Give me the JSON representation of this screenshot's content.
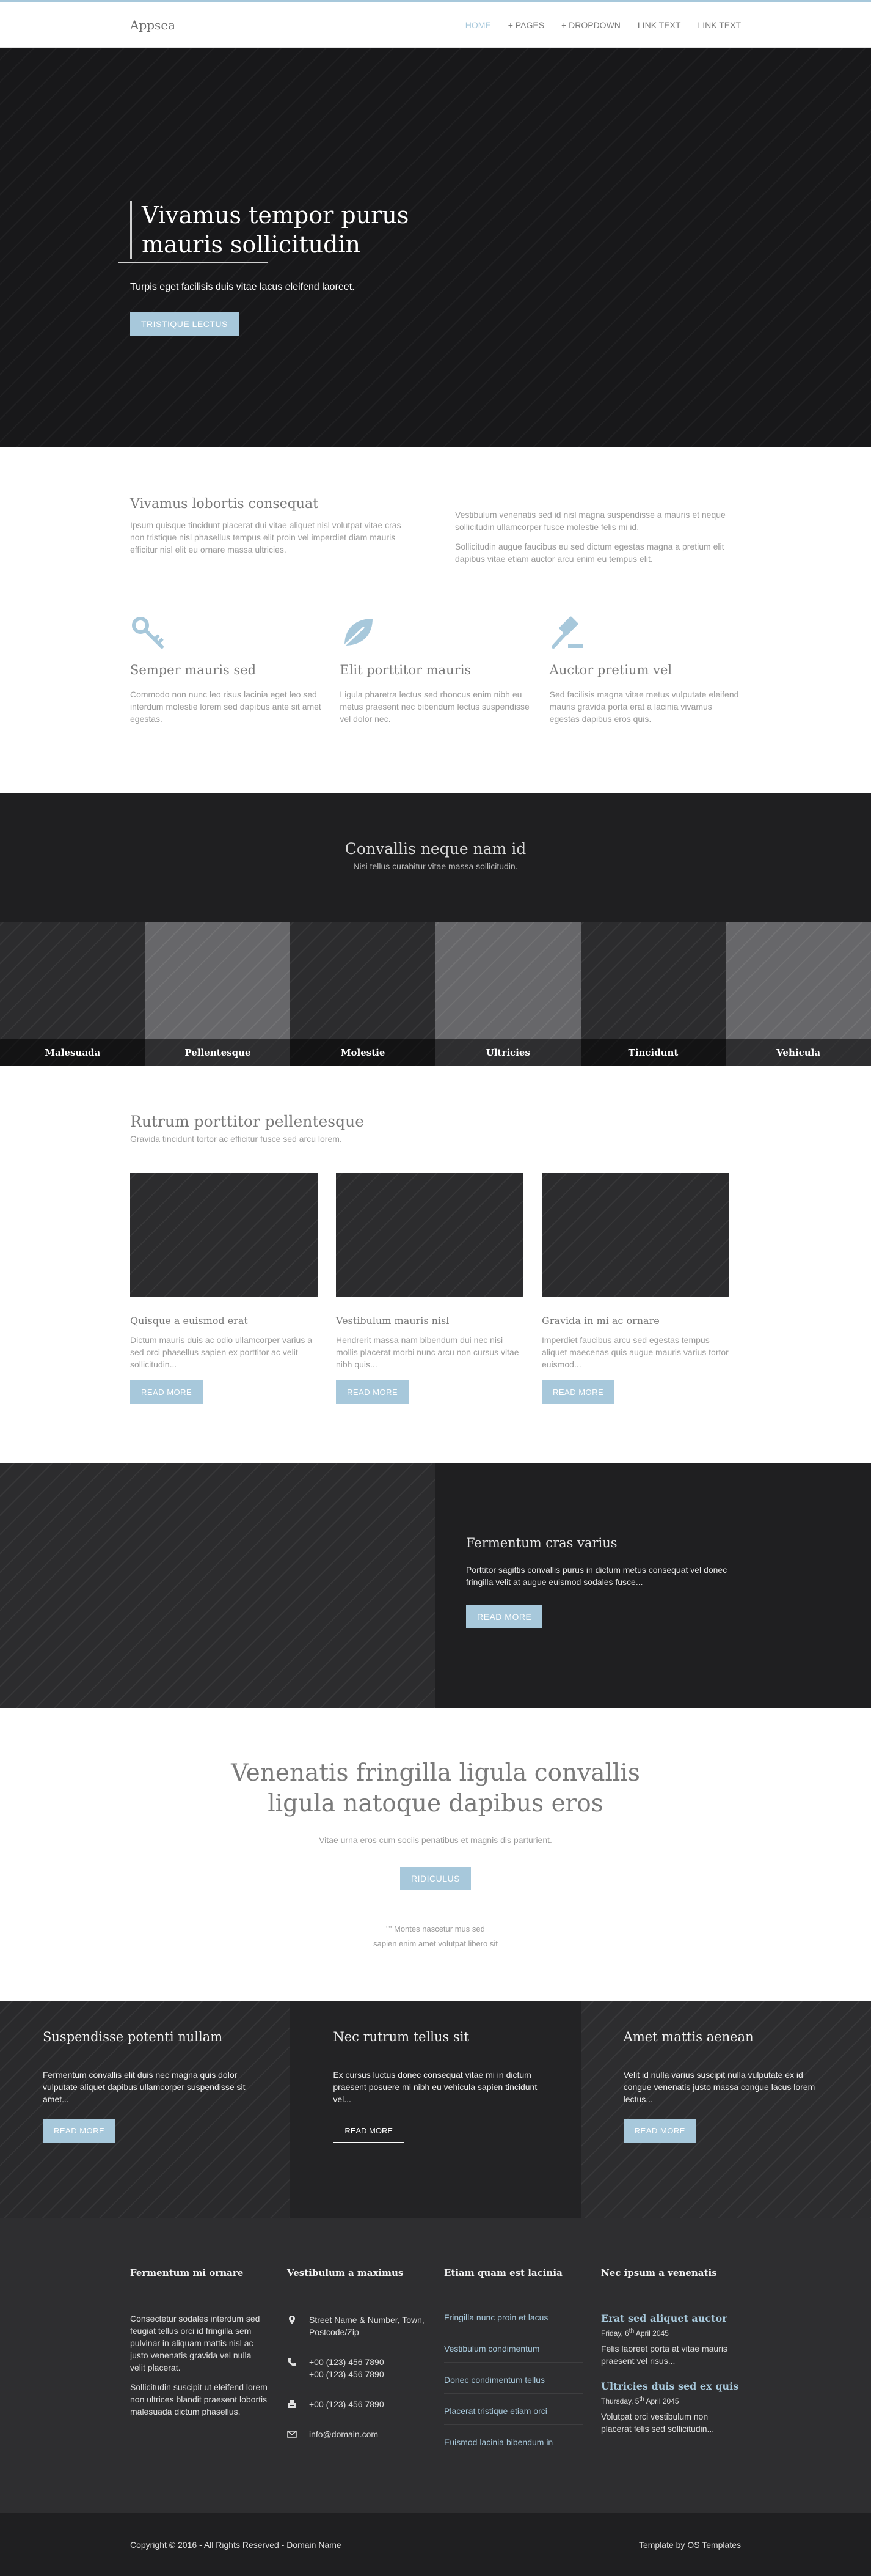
{
  "nav": {
    "brand": "Appsea",
    "items": [
      "HOME",
      "+ PAGES",
      "+ DROPDOWN",
      "LINK TEXT",
      "LINK TEXT"
    ]
  },
  "hero": {
    "title_line1": "Vivamus tempor purus",
    "title_line2": "mauris sollicitudin",
    "subtitle": "Turpis eget facilisis duis vitae lacus eleifend laoreet.",
    "button": "TRISTIQUE LECTUS"
  },
  "intro": {
    "heading": "Vivamus lobortis consequat",
    "left_text": "Ipsum quisque tincidunt placerat dui vitae aliquet nisl volutpat vitae cras non tristique nisl phasellus tempus elit proin vel imperdiet diam mauris efficitur nisl elit eu ornare massa ultricies.",
    "right_text_1": "Vestibulum venenatis sed id nisl magna suspendisse a mauris et neque sollicitudin ullamcorper fusce molestie felis mi id.",
    "right_text_2": "Sollicitudin augue faucibus eu sed dictum egestas magna a pretium elit dapibus vitae etiam auctor arcu enim eu tempus elit."
  },
  "features": [
    {
      "icon": "key-icon",
      "title": "Semper mauris sed",
      "text": "Commodo non nunc leo risus lacinia eget leo sed interdum molestie lorem sed dapibus ante sit amet egestas."
    },
    {
      "icon": "leaf-icon",
      "title": "Elit porttitor mauris",
      "text": "Ligula pharetra lectus sed rhoncus enim nibh eu metus praesent nec bibendum lectus suspendisse vel dolor nec."
    },
    {
      "icon": "gavel-icon",
      "title": "Auctor pretium vel",
      "text": "Sed facilisis magna vitae metus vulputate eleifend mauris gravida porta erat a lacinia vivamus egestas dapibus eros quis."
    }
  ],
  "band": {
    "title": "Convallis neque nam id",
    "subtitle": "Nisi tellus curabitur vitae massa sollicitudin."
  },
  "strip": [
    "Malesuada",
    "Pellentesque",
    "Molestie",
    "Ultricies",
    "Tincidunt",
    "Vehicula"
  ],
  "posts": {
    "heading": "Rutrum porttitor pellentesque",
    "subheading": "Gravida tincidunt tortor ac efficitur fusce sed arcu lorem.",
    "items": [
      {
        "title": "Quisque a euismod erat",
        "text": "Dictum mauris duis ac odio ullamcorper varius a sed orci phasellus sapien ex porttitor ac velit sollicitudin...",
        "button": "READ MORE"
      },
      {
        "title": "Vestibulum mauris nisl",
        "text": "Hendrerit massa nam bibendum dui nec nisi mollis placerat morbi nunc arcu non cursus vitae nibh quis...",
        "button": "READ MORE"
      },
      {
        "title": "Gravida in mi ac ornare",
        "text": "Imperdiet faucibus arcu sed egestas tempus aliquet maecenas quis augue mauris varius tortor euismod...",
        "button": "READ MORE"
      }
    ]
  },
  "split": {
    "title": "Fermentum cras varius",
    "text": "Porttitor sagittis convallis purus in dictum metus consequat vel donec fringilla velit at augue euismod sodales fusce...",
    "button": "READ MORE"
  },
  "cta": {
    "title_line1": "Venenatis fringilla ligula convallis",
    "title_line2": "ligula natoque dapibus eros",
    "subtitle": "Vitae urna eros cum sociis penatibus et magnis dis parturient.",
    "button": "RIDICULUS",
    "note_line1": "\"\" Montes nascetur mus sed",
    "note_line2": "sapien enim amet volutpat libero sit"
  },
  "triple": [
    {
      "title": "Suspendisse potenti nullam",
      "text": "Fermentum convallis elit duis nec magna quis dolor vulputate aliquet dapibus ullamcorper suspendisse sit amet...",
      "button": "READ MORE"
    },
    {
      "title": "Nec rutrum tellus sit",
      "text": "Ex cursus luctus donec consequat vitae mi in dictum praesent posuere mi nibh eu vehicula sapien tincidunt vel...",
      "button": "READ MORE"
    },
    {
      "title": "Amet mattis aenean",
      "text": "Velit id nulla varius suscipit nulla vulputate ex id congue venenatis justo massa congue lacus lorem lectus...",
      "button": "READ MORE"
    }
  ],
  "footer": {
    "col1": {
      "title": "Fermentum mi ornare",
      "p1": "Consectetur sodales interdum sed feugiat tellus orci id fringilla sem pulvinar in aliquam mattis nisl ac justo venenatis gravida vel nulla velit placerat.",
      "p2": "Sollicitudin suscipit ut eleifend lorem non ultrices blandit praesent lobortis malesuada dictum phasellus."
    },
    "col2": {
      "title": "Vestibulum a maximus",
      "address": "Street Name & Number, Town, Postcode/Zip",
      "phone": "+00 (123) 456 7890",
      "phone2": "+00 (123) 456 7890",
      "fax": "+00 (123) 456 7890",
      "email": "info@domain.com"
    },
    "col3": {
      "title": "Etiam quam est lacinia",
      "links": [
        "Fringilla nunc proin et lacus",
        "Vestibulum condimentum",
        "Donec condimentum tellus",
        "Placerat tristique etiam orci",
        "Euismod lacinia bibendum in"
      ]
    },
    "col4": {
      "title": "Nec ipsum a venenatis",
      "news": [
        {
          "title": "Erat sed aliquet auctor",
          "date_prefix": "Friday, 6",
          "date_sup": "th",
          "date_suffix": " April 2045",
          "text": "Felis laoreet porta at vitae mauris praesent vel risus..."
        },
        {
          "title": "Ultricies duis sed ex quis",
          "date_prefix": "Thursday, 5",
          "date_sup": "th",
          "date_suffix": " April 2045",
          "text": "Volutpat orci vestibulum non placerat felis sed sollicitudin..."
        }
      ]
    }
  },
  "bottom": {
    "copyright": "Copyright © 2016 - All Rights Reserved - Domain Name",
    "credit": "Template by OS Templates"
  },
  "colors": {
    "accent": "#a7c8db",
    "dark": "#1f1f21",
    "footer": "#2e2e30"
  }
}
